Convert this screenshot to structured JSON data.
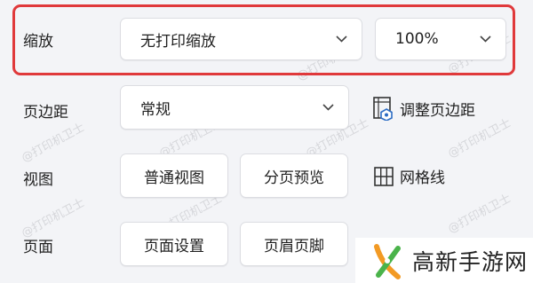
{
  "watermark": "@打印机卫士",
  "scaling": {
    "label": "缩放",
    "value": "无打印缩放",
    "zoom": "100%"
  },
  "margins": {
    "label": "页边距",
    "value": "常规",
    "adjust": "调整页边距"
  },
  "view": {
    "label": "视图",
    "normal": "普通视图",
    "page_break": "分页预览",
    "gridlines": "网格线"
  },
  "page": {
    "label": "页面",
    "setup": "页面设置",
    "header_footer": "页眉页脚"
  },
  "brand": {
    "name": "高新手游网",
    "colors": {
      "orange": "#f29a24",
      "green": "#4ab34a",
      "red": "#e0393b"
    }
  }
}
